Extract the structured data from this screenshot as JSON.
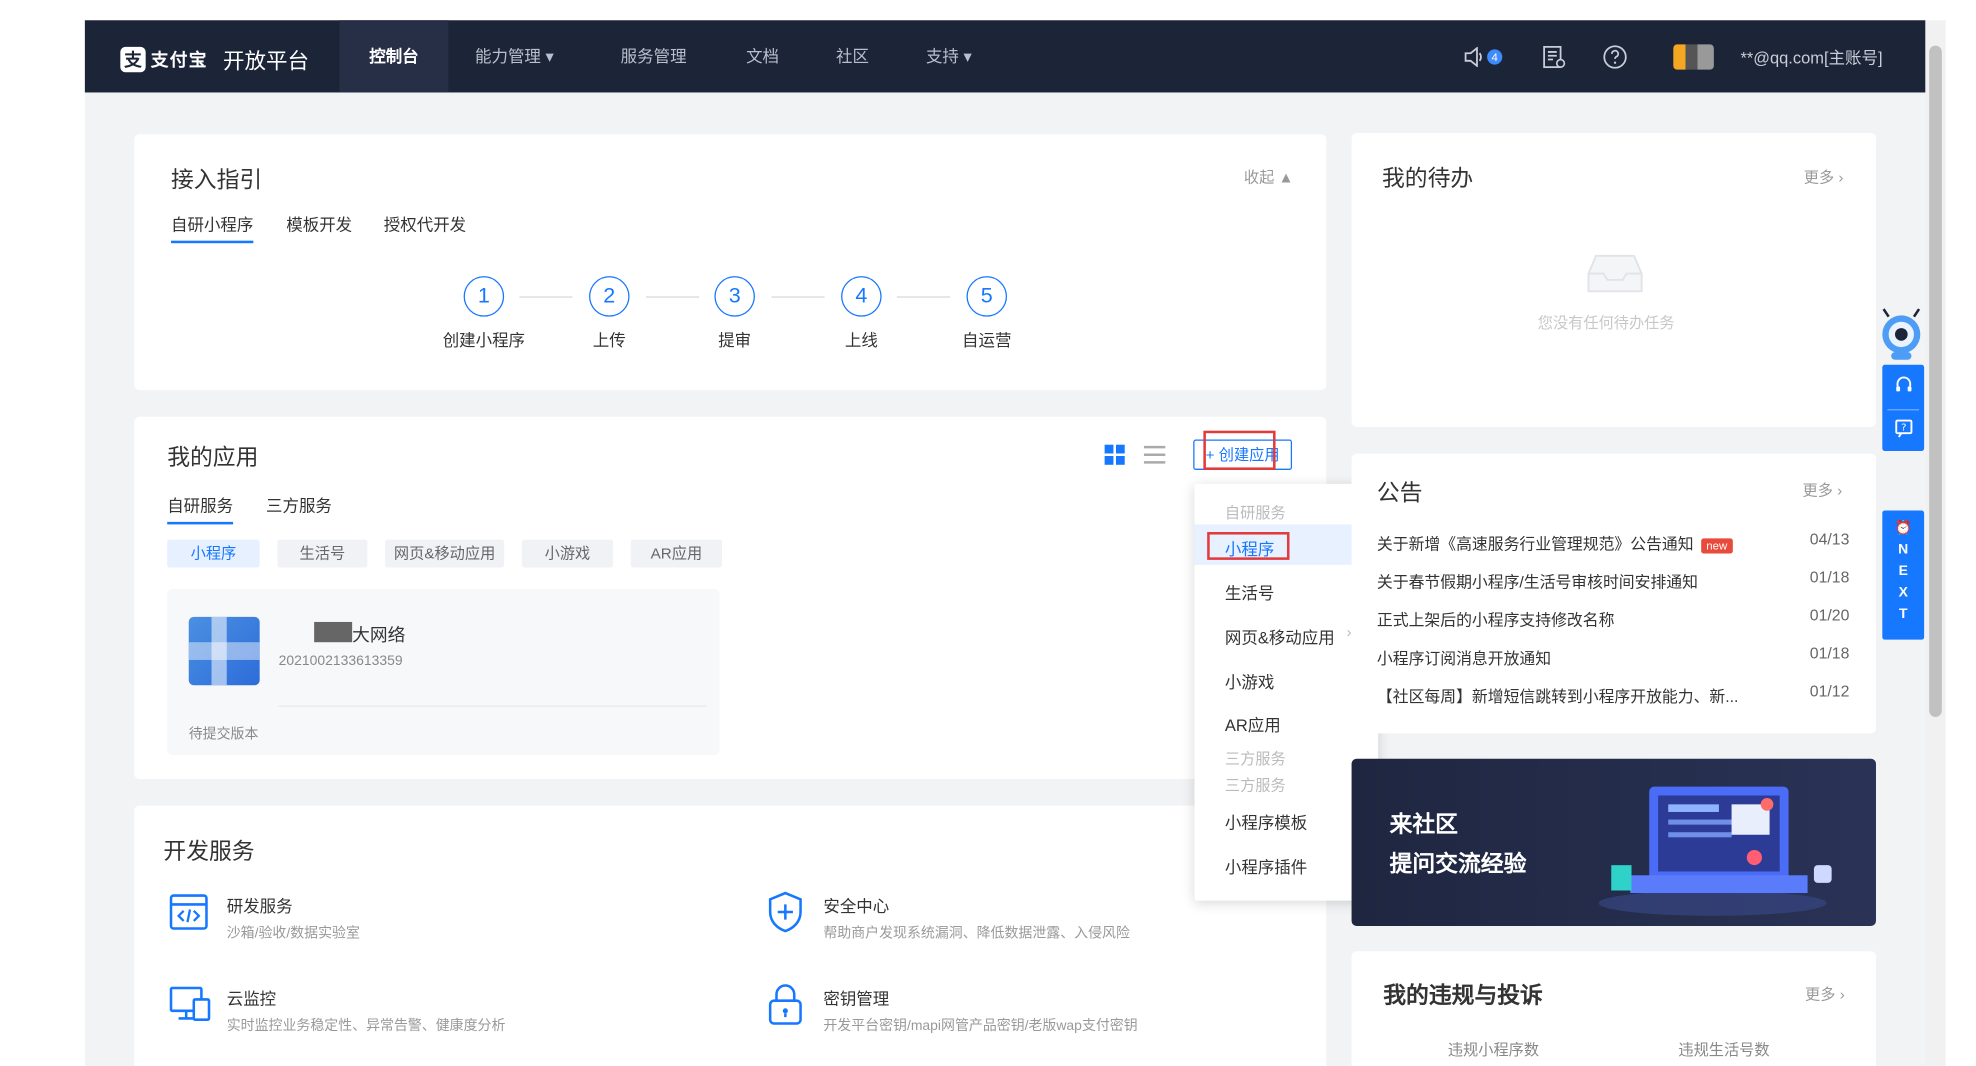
{
  "nav": {
    "logo_mark": "支",
    "logo_brand": "支付宝",
    "platform": "开放平台",
    "items": [
      {
        "label": "控制台"
      },
      {
        "label": "能力管理"
      },
      {
        "label": "服务管理"
      },
      {
        "label": "文档"
      },
      {
        "label": "社区"
      },
      {
        "label": "支持"
      }
    ],
    "msg_count": "4",
    "account": "**@qq.com[主账号]"
  },
  "guide": {
    "title": "接入指引",
    "collapse": "收起",
    "tabs": [
      "自研小程序",
      "模板开发",
      "授权代开发"
    ],
    "steps": [
      {
        "num": "1",
        "label": "创建小程序"
      },
      {
        "num": "2",
        "label": "上传"
      },
      {
        "num": "3",
        "label": "提审"
      },
      {
        "num": "4",
        "label": "上线"
      },
      {
        "num": "5",
        "label": "自运营"
      }
    ]
  },
  "apps": {
    "title": "我的应用",
    "create_button": "+ 创建应用",
    "tabs": [
      "自研服务",
      "三方服务"
    ],
    "chips": [
      "小程序",
      "生活号",
      "网页&移动应用",
      "小游戏",
      "AR应用"
    ],
    "app": {
      "name": "大网络",
      "id": "2021002133613359",
      "status": "待提交版本"
    }
  },
  "dropdown": {
    "group1": "自研服务",
    "items1": [
      "小程序",
      "生活号",
      "网页&移动应用",
      "小游戏",
      "AR应用"
    ],
    "group2": "三方服务",
    "items2": [
      "小程序模板",
      "小程序插件"
    ]
  },
  "dev": {
    "title": "开发服务",
    "services": [
      {
        "title": "研发服务",
        "desc": "沙箱/验收/数据实验室"
      },
      {
        "title": "安全中心",
        "desc": "帮助商户发现系统漏洞、降低数据泄露、入侵风险"
      },
      {
        "title": "云监控",
        "desc": "实时监控业务稳定性、异常告警、健康度分析"
      },
      {
        "title": "密钥管理",
        "desc": "开发平台密钥/mapi网管产品密钥/老版wap支付密钥"
      }
    ]
  },
  "todo": {
    "title": "我的待办",
    "more": "更多",
    "empty": "您没有任何待办任务"
  },
  "notice": {
    "title": "公告",
    "more": "更多",
    "new_tag": "new",
    "items": [
      {
        "text": "关于新增《高速服务行业管理规范》公告通知",
        "date": "04/13"
      },
      {
        "text": "关于春节假期小程序/生活号审核时间安排通知",
        "date": "01/18"
      },
      {
        "text": "正式上架后的小程序支持修改名称",
        "date": "01/20"
      },
      {
        "text": "小程序订阅消息开放通知",
        "date": "01/18"
      },
      {
        "text": "【社区每周】新增短信跳转到小程序开放能力、新...",
        "date": "01/12"
      }
    ]
  },
  "banner": {
    "line1": "来社区",
    "line2": "提问交流经验"
  },
  "violations": {
    "title": "我的违规与投诉",
    "more": "更多",
    "cols": [
      "违规小程序数",
      "违规生活号数"
    ]
  },
  "next_label": [
    "N",
    "E",
    "X",
    "T"
  ],
  "colors": {
    "nav_bg": "#1c2438",
    "accent": "#1677ff",
    "highlight": "#e23b3b"
  }
}
